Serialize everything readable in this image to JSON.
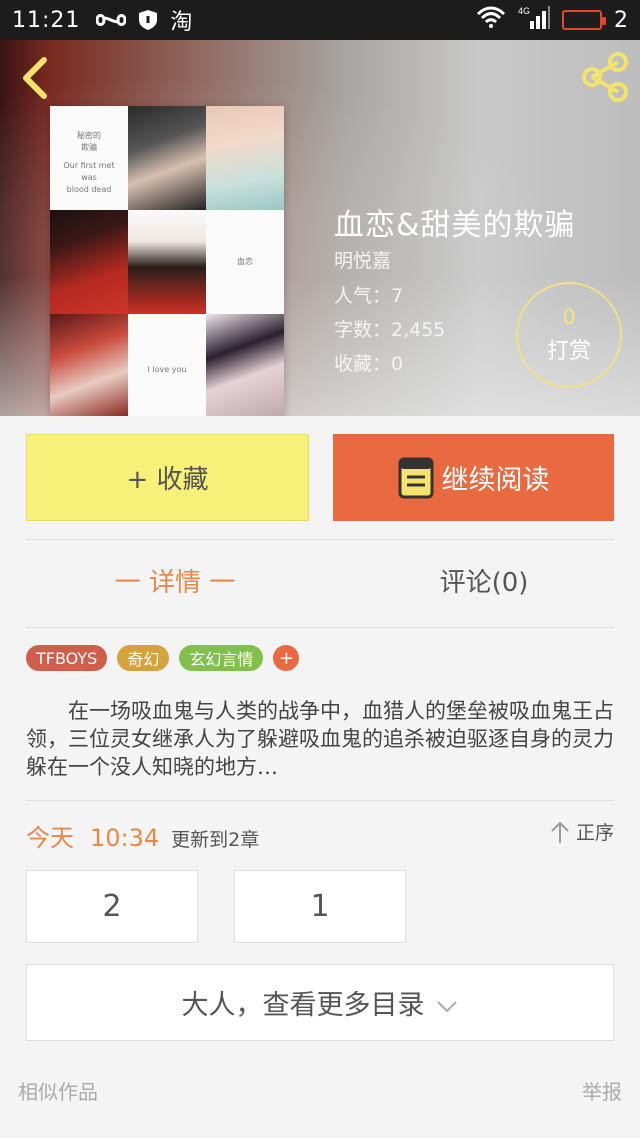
{
  "status_bar": {
    "time": "11:21",
    "app_icon": "淘",
    "network": "4G",
    "battery_level": "2",
    "icons": [
      "infinity-icon",
      "shield-icon",
      "taobao-icon",
      "wifi-icon",
      "signal-icon",
      "battery-icon"
    ]
  },
  "header": {
    "back_icon": "chevron-left-icon",
    "share_icon": "share-icon",
    "accent": "#f3e36b"
  },
  "cover": {
    "texts": [
      "秘密的",
      "欺骗",
      "Our first met",
      "was",
      "blood dead",
      "血恋",
      "I love you"
    ]
  },
  "book": {
    "title": "血恋&甜美的欺骗",
    "author": "明悦嘉",
    "popularity": "人气：7",
    "word_count": "字数：2,455",
    "favorites": "收藏：0"
  },
  "tip": {
    "count": "0",
    "label": "打赏"
  },
  "actions": {
    "favorite_label": "+ 收藏",
    "read_label": "继续阅读",
    "read_icon": "book-icon",
    "read_color": "#e96a40",
    "favorite_color": "#f7f17a"
  },
  "tabs": {
    "detail": "一 详情 一",
    "comments": "评论(0)"
  },
  "tags": [
    "TFBOYS",
    "奇幻",
    "玄幻言情",
    "+"
  ],
  "description": "在一场吸血鬼与人类的战争中，血猎人的堡垒被吸血鬼王占领，三位灵女继承人为了躲避吸血鬼的追杀被迫驱逐自身的灵力躲在一个没人知晓的地方…",
  "update": {
    "day": "今天",
    "time": "10:34",
    "text": "更新到2章",
    "sort_label": "正序",
    "sort_icon": "arrow-up-icon"
  },
  "chapters": [
    "2",
    "1"
  ],
  "more_catalog": "大人，查看更多目录",
  "footer": {
    "similar": "相似作品",
    "report": "举报"
  }
}
